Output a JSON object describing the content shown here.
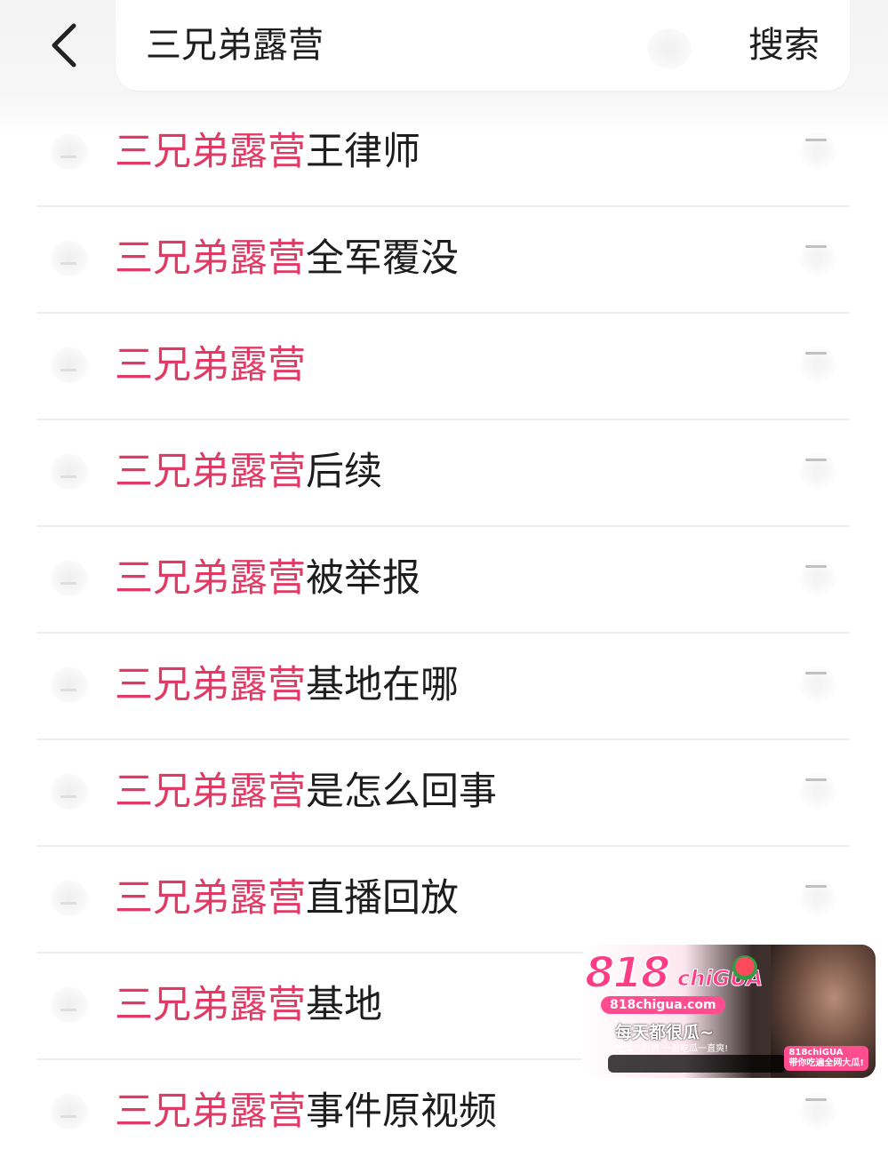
{
  "search": {
    "query": "三兄弟露营",
    "button_label": "搜索"
  },
  "suggestions": [
    {
      "highlight": "三兄弟露营",
      "rest": "王律师"
    },
    {
      "highlight": "三兄弟露营",
      "rest": "全军覆没"
    },
    {
      "highlight": "三兄弟露营",
      "rest": ""
    },
    {
      "highlight": "三兄弟露营",
      "rest": "后续"
    },
    {
      "highlight": "三兄弟露营",
      "rest": "被举报"
    },
    {
      "highlight": "三兄弟露营",
      "rest": "基地在哪"
    },
    {
      "highlight": "三兄弟露营",
      "rest": "是怎么回事"
    },
    {
      "highlight": "三兄弟露营",
      "rest": "直播回放"
    },
    {
      "highlight": "三兄弟露营",
      "rest": "基地"
    },
    {
      "highlight": "三兄弟露营",
      "rest": "事件原视频"
    }
  ],
  "promo": {
    "logo": "818",
    "logo_suffix": "chiGUA",
    "url": "818chigua.com",
    "slogan": "每天都很瓜~",
    "sub": "吃瓜一时爽 一直吃瓜一直爽!",
    "badge": "818chiGUA",
    "badge_sub": "带你吃遍全网大瓜!"
  },
  "colors": {
    "highlight": "#e23a64",
    "text": "#1d1d1d",
    "divider": "#eeeeee"
  }
}
